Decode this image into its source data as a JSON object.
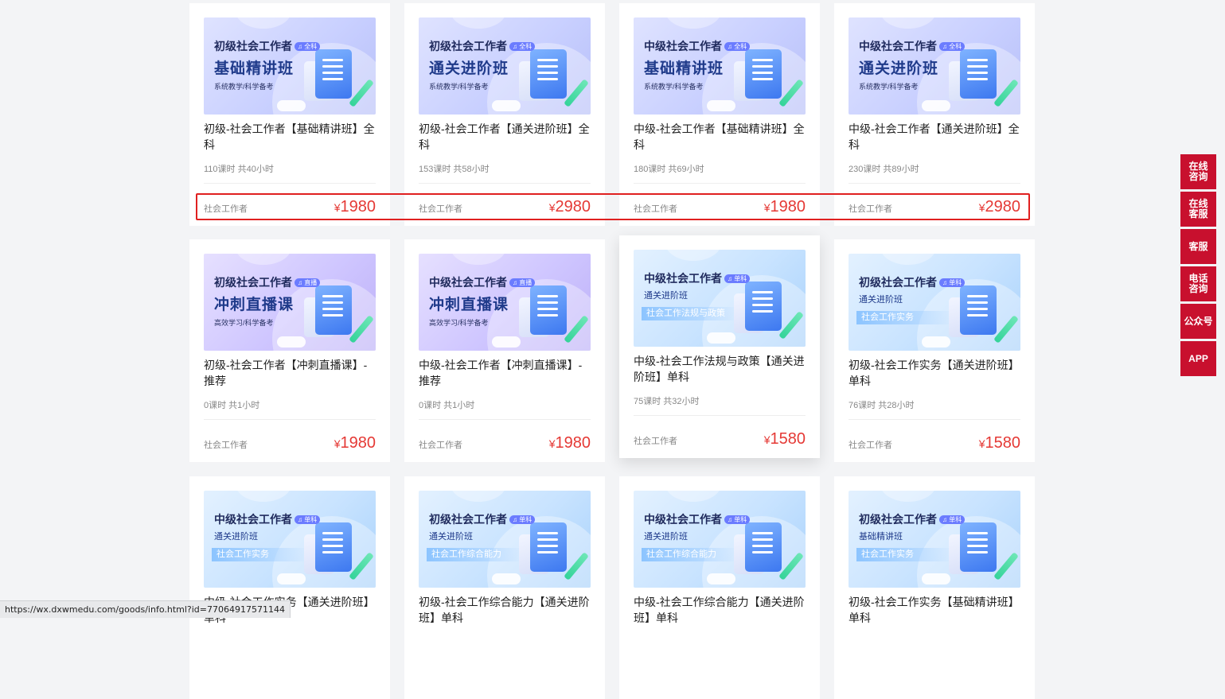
{
  "courses": [
    {
      "banner_level": "初级社会工作者",
      "banner_tag": "全科",
      "banner_title": "基础精讲班",
      "banner_sub": "系统教学/科学备考",
      "banner_band": "",
      "theme": "purple",
      "title": "初级-社会工作者【基础精讲班】全科",
      "meta": "110课时 共40小时",
      "category": "社会工作者",
      "price": "1980"
    },
    {
      "banner_level": "初级社会工作者",
      "banner_tag": "全科",
      "banner_title": "通关进阶班",
      "banner_sub": "系统教学/科学备考",
      "banner_band": "",
      "theme": "purple",
      "title": "初级-社会工作者【通关进阶班】全科",
      "meta": "153课时 共58小时",
      "category": "社会工作者",
      "price": "2980"
    },
    {
      "banner_level": "中级社会工作者",
      "banner_tag": "全科",
      "banner_title": "基础精讲班",
      "banner_sub": "系统教学/科学备考",
      "banner_band": "",
      "theme": "purple",
      "title": "中级-社会工作者【基础精讲班】全科",
      "meta": "180课时 共69小时",
      "category": "社会工作者",
      "price": "1980"
    },
    {
      "banner_level": "中级社会工作者",
      "banner_tag": "全科",
      "banner_title": "通关进阶班",
      "banner_sub": "系统教学/科学备考",
      "banner_band": "",
      "theme": "purple",
      "title": "中级-社会工作者【通关进阶班】全科",
      "meta": "230课时 共89小时",
      "category": "社会工作者",
      "price": "2980"
    },
    {
      "banner_level": "初级社会工作者",
      "banner_tag": "直播",
      "banner_title": "冲刺直播课",
      "banner_sub": "高效学习/科学备考",
      "banner_band": "",
      "theme": "violet",
      "title": "初级-社会工作者【冲刺直播课】-推荐",
      "meta": "0课时 共1小时",
      "category": "社会工作者",
      "price": "1980"
    },
    {
      "banner_level": "中级社会工作者",
      "banner_tag": "直播",
      "banner_title": "冲刺直播课",
      "banner_sub": "高效学习/科学备考",
      "banner_band": "",
      "theme": "violet",
      "title": "中级-社会工作者【冲刺直播课】-推荐",
      "meta": "0课时 共1小时",
      "category": "社会工作者",
      "price": "1980"
    },
    {
      "banner_level": "中级社会工作者",
      "banner_tag": "单科",
      "banner_title": "通关进阶班",
      "banner_sub": "",
      "banner_band": "社会工作法规与政策",
      "theme": "blue",
      "title": "中级-社会工作法规与政策【通关进阶班】单科",
      "meta": "75课时 共32小时",
      "category": "社会工作者",
      "price": "1580"
    },
    {
      "banner_level": "初级社会工作者",
      "banner_tag": "单科",
      "banner_title": "通关进阶班",
      "banner_sub": "",
      "banner_band": "社会工作实务",
      "theme": "blue",
      "title": "初级-社会工作实务【通关进阶班】单科",
      "meta": "76课时 共28小时",
      "category": "社会工作者",
      "price": "1580"
    },
    {
      "banner_level": "中级社会工作者",
      "banner_tag": "单科",
      "banner_title": "通关进阶班",
      "banner_sub": "",
      "banner_band": "社会工作实务",
      "theme": "blue",
      "title": "中级-社会工作实务【通关进阶班】单科",
      "meta": "",
      "category": "",
      "price": ""
    },
    {
      "banner_level": "初级社会工作者",
      "banner_tag": "单科",
      "banner_title": "通关进阶班",
      "banner_sub": "",
      "banner_band": "社会工作综合能力",
      "theme": "blue",
      "title": "初级-社会工作综合能力【通关进阶班】单科",
      "meta": "",
      "category": "",
      "price": ""
    },
    {
      "banner_level": "中级社会工作者",
      "banner_tag": "单科",
      "banner_title": "通关进阶班",
      "banner_sub": "",
      "banner_band": "社会工作综合能力",
      "theme": "blue",
      "title": "中级-社会工作综合能力【通关进阶班】单科",
      "meta": "",
      "category": "",
      "price": ""
    },
    {
      "banner_level": "初级社会工作者",
      "banner_tag": "单科",
      "banner_title": "基础精讲班",
      "banner_sub": "",
      "banner_band": "社会工作实务",
      "theme": "blue",
      "title": "初级-社会工作实务【基础精讲班】单科",
      "meta": "",
      "category": "",
      "price": ""
    }
  ],
  "currency_symbol": "¥",
  "hovered_card_index": 6,
  "sidebar": [
    {
      "label": "在线咨询",
      "icon": "chat-consult"
    },
    {
      "label": "在线客服",
      "icon": "online-service"
    },
    {
      "label": "客服",
      "icon": "service"
    },
    {
      "label": "电话咨询",
      "icon": "phone"
    },
    {
      "label": "公众号",
      "icon": "wechat-official"
    },
    {
      "label": "APP",
      "icon": "app"
    }
  ],
  "status_url": "https://wx.dxwmedu.com/goods/info.html?id=77064917571144",
  "colors": {
    "price": "#e53935",
    "sidebar": "#c8102e",
    "highlight": "#e02020"
  }
}
